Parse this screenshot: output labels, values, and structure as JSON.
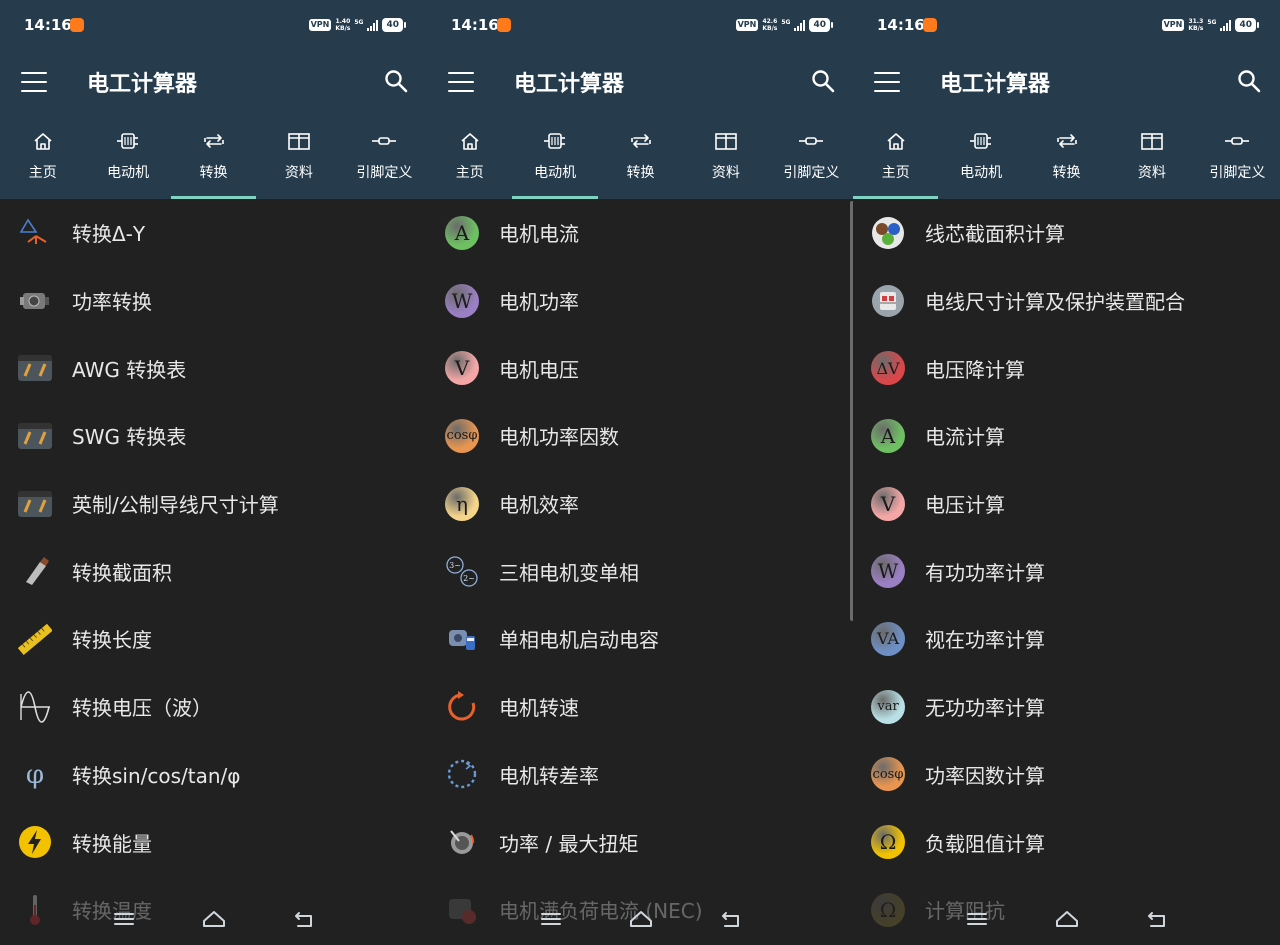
{
  "app_title": "电工计算器",
  "colors": {
    "header": "#263c4d",
    "accent": "#7fd3c5",
    "background": "#212121"
  },
  "tabs": [
    "主页",
    "电动机",
    "转换",
    "资料",
    "引脚定义"
  ],
  "panels": [
    {
      "status": {
        "time": "14:16",
        "vpn": "VPN",
        "speed": "1.40",
        "speed_unit": "KB/s",
        "network": "5G",
        "battery": "40"
      },
      "active_tab": 2,
      "items": [
        {
          "label": "转换Δ-Y",
          "icon": "delta-star-icon"
        },
        {
          "label": "功率转换",
          "icon": "engine-icon"
        },
        {
          "label": "AWG 转换表",
          "icon": "wire-table-icon"
        },
        {
          "label": "SWG 转换表",
          "icon": "wire-table-icon"
        },
        {
          "label": "英制/公制导线尺寸计算",
          "icon": "wire-table-icon"
        },
        {
          "label": "转换截面积",
          "icon": "cable-cut-icon"
        },
        {
          "label": "转换长度",
          "icon": "ruler-icon"
        },
        {
          "label": "转换电压（波）",
          "icon": "sine-wave-icon"
        },
        {
          "label": "转换sin/cos/tan/φ",
          "icon": "phi-icon"
        },
        {
          "label": "转换能量",
          "icon": "lightning-icon"
        },
        {
          "label": "转换温度",
          "icon": "thermometer-icon"
        }
      ]
    },
    {
      "status": {
        "time": "14:16",
        "vpn": "VPN",
        "speed": "42.6",
        "speed_unit": "KB/s",
        "network": "5G",
        "battery": "40"
      },
      "active_tab": 1,
      "items": [
        {
          "label": "电机电流",
          "icon": "A",
          "color": "#6ec063"
        },
        {
          "label": "电机功率",
          "icon": "W",
          "color": "#9b7fc4"
        },
        {
          "label": "电机电压",
          "icon": "V",
          "color": "#f5a7a7"
        },
        {
          "label": "电机功率因数",
          "icon": "cosφ",
          "color": "#e89550"
        },
        {
          "label": "电机效率",
          "icon": "η",
          "color": "#f5d58a"
        },
        {
          "label": "三相电机变单相",
          "icon": "phase-convert-icon"
        },
        {
          "label": "单相电机启动电容",
          "icon": "motor-capacitor-icon"
        },
        {
          "label": "电机转速",
          "icon": "rotation-icon"
        },
        {
          "label": "电机转差率",
          "icon": "slip-icon"
        },
        {
          "label": "功率 / 最大扭矩",
          "icon": "torque-icon"
        },
        {
          "label": "电机满负荷电流 (NEC)",
          "icon": "nec-motor-icon"
        }
      ]
    },
    {
      "status": {
        "time": "14:16",
        "vpn": "VPN",
        "speed": "31.3",
        "speed_unit": "KB/s",
        "network": "5G",
        "battery": "40"
      },
      "active_tab": 0,
      "items": [
        {
          "label": "线芯截面积计算",
          "icon": "wire-core-icon"
        },
        {
          "label": "电线尺寸计算及保护装置配合",
          "icon": "breaker-icon"
        },
        {
          "label": "电压降计算",
          "icon": "ΔV",
          "color": "#d9474a"
        },
        {
          "label": "电流计算",
          "icon": "A",
          "color": "#6ec063"
        },
        {
          "label": "电压计算",
          "icon": "V",
          "color": "#f5a7a7"
        },
        {
          "label": "有功功率计算",
          "icon": "W",
          "color": "#9b7fc4"
        },
        {
          "label": "视在功率计算",
          "icon": "VA",
          "color": "#6e8fc4"
        },
        {
          "label": "无功功率计算",
          "icon": "var",
          "color": "#b8e0e6"
        },
        {
          "label": "功率因数计算",
          "icon": "cosφ",
          "color": "#e89550"
        },
        {
          "label": "负载阻值计算",
          "icon": "Ω",
          "color": "#f2c200"
        },
        {
          "label": "计算阻抗",
          "icon": "Ω",
          "color": "#8a7a3a"
        }
      ]
    }
  ]
}
